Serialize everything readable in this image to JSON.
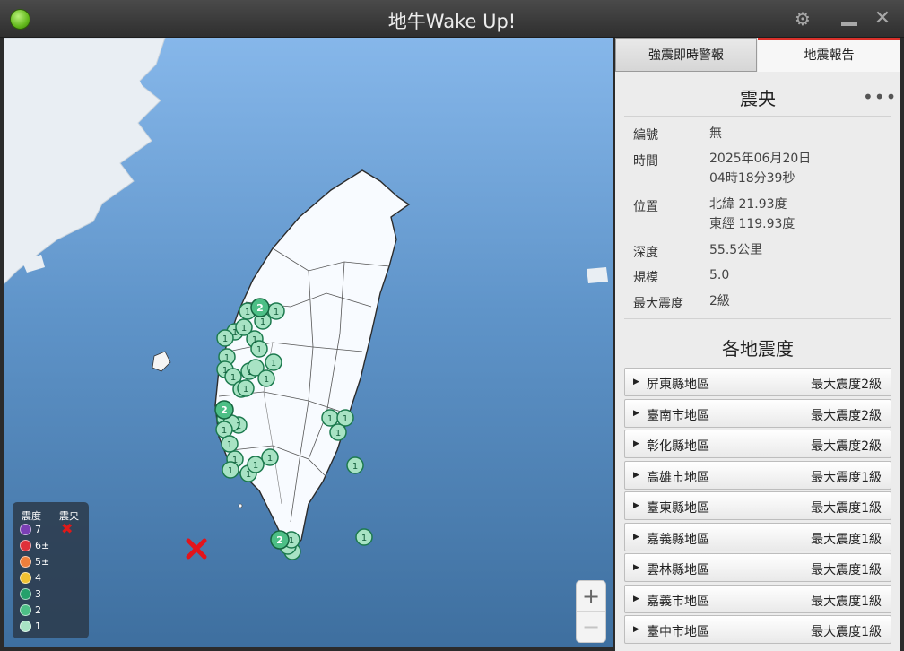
{
  "window": {
    "title": "地牛Wake Up!",
    "icons": [
      "gear-icon",
      "minimize-icon",
      "close-icon"
    ]
  },
  "tabs": [
    {
      "label": "強震即時警報",
      "active": false
    },
    {
      "label": "地震報告",
      "active": true
    }
  ],
  "epicenter_section": {
    "title": "震央",
    "more_label": "•••",
    "fields": [
      {
        "key": "編號",
        "value": "無"
      },
      {
        "key": "時間",
        "value": "2025年06月20日",
        "value2": "04時18分39秒"
      },
      {
        "key": "位置",
        "value": "北緯 21.93度",
        "value2": "東經 119.93度"
      },
      {
        "key": "深度",
        "value": "55.5公里"
      },
      {
        "key": "規模",
        "value": "5.0"
      },
      {
        "key": "最大震度",
        "value": "2級"
      }
    ]
  },
  "regions_section": {
    "title": "各地震度",
    "items": [
      {
        "name": "屏東縣地區",
        "max": "最大震度2級"
      },
      {
        "name": "臺南市地區",
        "max": "最大震度2級"
      },
      {
        "name": "彰化縣地區",
        "max": "最大震度2級"
      },
      {
        "name": "高雄市地區",
        "max": "最大震度1級"
      },
      {
        "name": "臺東縣地區",
        "max": "最大震度1級"
      },
      {
        "name": "嘉義縣地區",
        "max": "最大震度1級"
      },
      {
        "name": "雲林縣地區",
        "max": "最大震度1級"
      },
      {
        "name": "嘉義市地區",
        "max": "最大震度1級"
      },
      {
        "name": "臺中市地區",
        "max": "最大震度1級"
      }
    ]
  },
  "legend": {
    "intensity_header": "震度",
    "epicenter_header": "震央",
    "levels": [
      {
        "label": "7",
        "color": "#7b3fb5"
      },
      {
        "label": "6±",
        "color": "#e0303a"
      },
      {
        "label": "5±",
        "color": "#ef7f3c"
      },
      {
        "label": "4",
        "color": "#f1c232"
      },
      {
        "label": "3",
        "color": "#24a06b"
      },
      {
        "label": "2",
        "color": "#4dbf86"
      },
      {
        "label": "1",
        "color": "#a8e3c4"
      }
    ]
  },
  "zoom": {
    "in_label": "+",
    "out_label": "−"
  },
  "stations": [
    {
      "label": "2"
    },
    {
      "label": "2"
    },
    {
      "label": "2"
    }
  ]
}
